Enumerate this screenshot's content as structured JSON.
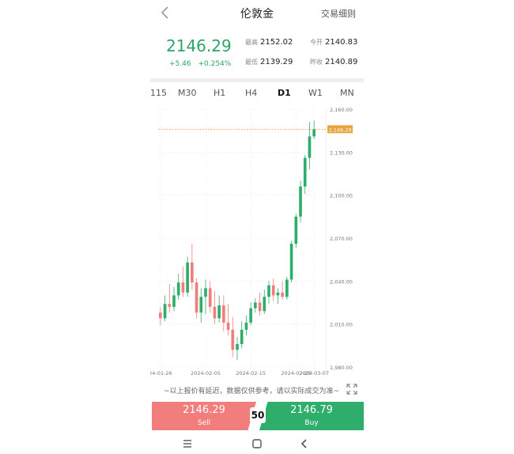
{
  "header": {
    "title": "伦敦金",
    "rules_label": "交易细则",
    "back_icon": "chevron-left-icon"
  },
  "quote": {
    "price": "2146.29",
    "change": "+5.46",
    "change_pct": "+0.254%",
    "high_label": "最高",
    "high": "2152.02",
    "low_label": "最低",
    "low": "2139.29",
    "open_label": "今开",
    "open": "2140.83",
    "prev_close_label": "昨收",
    "prev_close": "2140.89",
    "up_color": "#2ea36a"
  },
  "timeframes": [
    "115",
    "M30",
    "H1",
    "H4",
    "D1",
    "W1",
    "MN"
  ],
  "active_timeframe": "D1",
  "chart_data": {
    "type": "candlestick",
    "price_label": "2,146.29",
    "y_ticks": [
      "2,160.00",
      "2,130.00",
      "2,100.00",
      "2,070.00",
      "2,040.00",
      "2,010.00",
      "1,980.00"
    ],
    "x_ticks": [
      "24-01-26",
      "2024-02-05",
      "2024-02-15",
      "2024-02-25",
      "2024-03-07"
    ],
    "ylim": [
      1980,
      2160
    ],
    "colors": {
      "up": "#2fad6b",
      "down": "#f27d7d",
      "last_line": "#e8a33d"
    },
    "candles": [
      {
        "o": 2018,
        "h": 2022,
        "l": 2009,
        "c": 2014
      },
      {
        "o": 2014,
        "h": 2030,
        "l": 2012,
        "c": 2024
      },
      {
        "o": 2024,
        "h": 2038,
        "l": 2018,
        "c": 2022
      },
      {
        "o": 2022,
        "h": 2036,
        "l": 2019,
        "c": 2030
      },
      {
        "o": 2030,
        "h": 2045,
        "l": 2027,
        "c": 2039
      },
      {
        "o": 2039,
        "h": 2050,
        "l": 2029,
        "c": 2032
      },
      {
        "o": 2032,
        "h": 2057,
        "l": 2029,
        "c": 2053
      },
      {
        "o": 2053,
        "h": 2066,
        "l": 2034,
        "c": 2039
      },
      {
        "o": 2039,
        "h": 2042,
        "l": 2014,
        "c": 2018
      },
      {
        "o": 2018,
        "h": 2035,
        "l": 2011,
        "c": 2029
      },
      {
        "o": 2029,
        "h": 2041,
        "l": 2017,
        "c": 2035
      },
      {
        "o": 2035,
        "h": 2040,
        "l": 2018,
        "c": 2022
      },
      {
        "o": 2022,
        "h": 2033,
        "l": 2010,
        "c": 2014
      },
      {
        "o": 2014,
        "h": 2030,
        "l": 2011,
        "c": 2023
      },
      {
        "o": 2023,
        "h": 2030,
        "l": 2005,
        "c": 2011
      },
      {
        "o": 2011,
        "h": 2024,
        "l": 2002,
        "c": 2006
      },
      {
        "o": 2006,
        "h": 2015,
        "l": 1987,
        "c": 1992
      },
      {
        "o": 1992,
        "h": 2001,
        "l": 1985,
        "c": 1996
      },
      {
        "o": 1996,
        "h": 2012,
        "l": 1993,
        "c": 2006
      },
      {
        "o": 2006,
        "h": 2016,
        "l": 2002,
        "c": 2011
      },
      {
        "o": 2011,
        "h": 2025,
        "l": 2009,
        "c": 2021
      },
      {
        "o": 2021,
        "h": 2028,
        "l": 2018,
        "c": 2025
      },
      {
        "o": 2025,
        "h": 2032,
        "l": 2016,
        "c": 2019
      },
      {
        "o": 2019,
        "h": 2034,
        "l": 2017,
        "c": 2029
      },
      {
        "o": 2029,
        "h": 2040,
        "l": 2024,
        "c": 2037
      },
      {
        "o": 2037,
        "h": 2042,
        "l": 2026,
        "c": 2030
      },
      {
        "o": 2030,
        "h": 2035,
        "l": 2024,
        "c": 2032
      },
      {
        "o": 2032,
        "h": 2040,
        "l": 2027,
        "c": 2029
      },
      {
        "o": 2029,
        "h": 2043,
        "l": 2027,
        "c": 2041
      },
      {
        "o": 2041,
        "h": 2068,
        "l": 2039,
        "c": 2066
      },
      {
        "o": 2066,
        "h": 2087,
        "l": 2063,
        "c": 2085
      },
      {
        "o": 2085,
        "h": 2110,
        "l": 2081,
        "c": 2106
      },
      {
        "o": 2106,
        "h": 2128,
        "l": 2101,
        "c": 2126
      },
      {
        "o": 2126,
        "h": 2151,
        "l": 2118,
        "c": 2141
      },
      {
        "o": 2141,
        "h": 2152,
        "l": 2139,
        "c": 2146
      }
    ]
  },
  "disclaimer": "~以上报价有延迟，数据仅供参考，请以实际成交为准~",
  "trade": {
    "sell_price": "2146.29",
    "sell_label": "Sell",
    "buy_price": "2146.79",
    "buy_label": "Buy",
    "spread": "50"
  }
}
